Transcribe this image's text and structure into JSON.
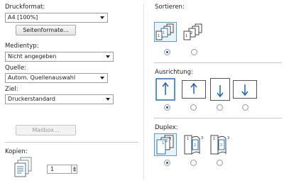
{
  "left": {
    "druckformat_label": "Druckformat:",
    "druckformat_value": "A4  [100%]",
    "seitenformate_button": "Seitenformate...",
    "medientyp_label": "Medientyp:",
    "medientyp_value": "Nicht angegeben",
    "quelle_label": "Quelle:",
    "quelle_value": "Autom. Quellenauswahl",
    "ziel_label": "Ziel:",
    "ziel_value": "Druckerstandard",
    "mailbox_button": "Mailbox...",
    "kopien_label": "Kopien:",
    "kopien_value": "1"
  },
  "right": {
    "sortieren_label": "Sortieren:",
    "ausrichtung_label": "Ausrichtung:",
    "duplex_label": "Duplex:"
  },
  "selection": {
    "sortieren": 0,
    "ausrichtung": 0,
    "duplex": 0
  },
  "icons": {
    "sortieren": [
      "collated-pages-icon",
      "uncollated-pages-icon"
    ],
    "ausrichtung": [
      "portrait-up-icon",
      "landscape-up-icon",
      "portrait-down-icon",
      "landscape-down-icon"
    ],
    "duplex": [
      "simplex-icon",
      "duplex-long-edge-icon",
      "duplex-short-edge-icon"
    ],
    "kopien": "copies-stack-icon"
  },
  "colors": {
    "accent": "#1d6fc4",
    "arrow_blue": "#1f64b5"
  }
}
